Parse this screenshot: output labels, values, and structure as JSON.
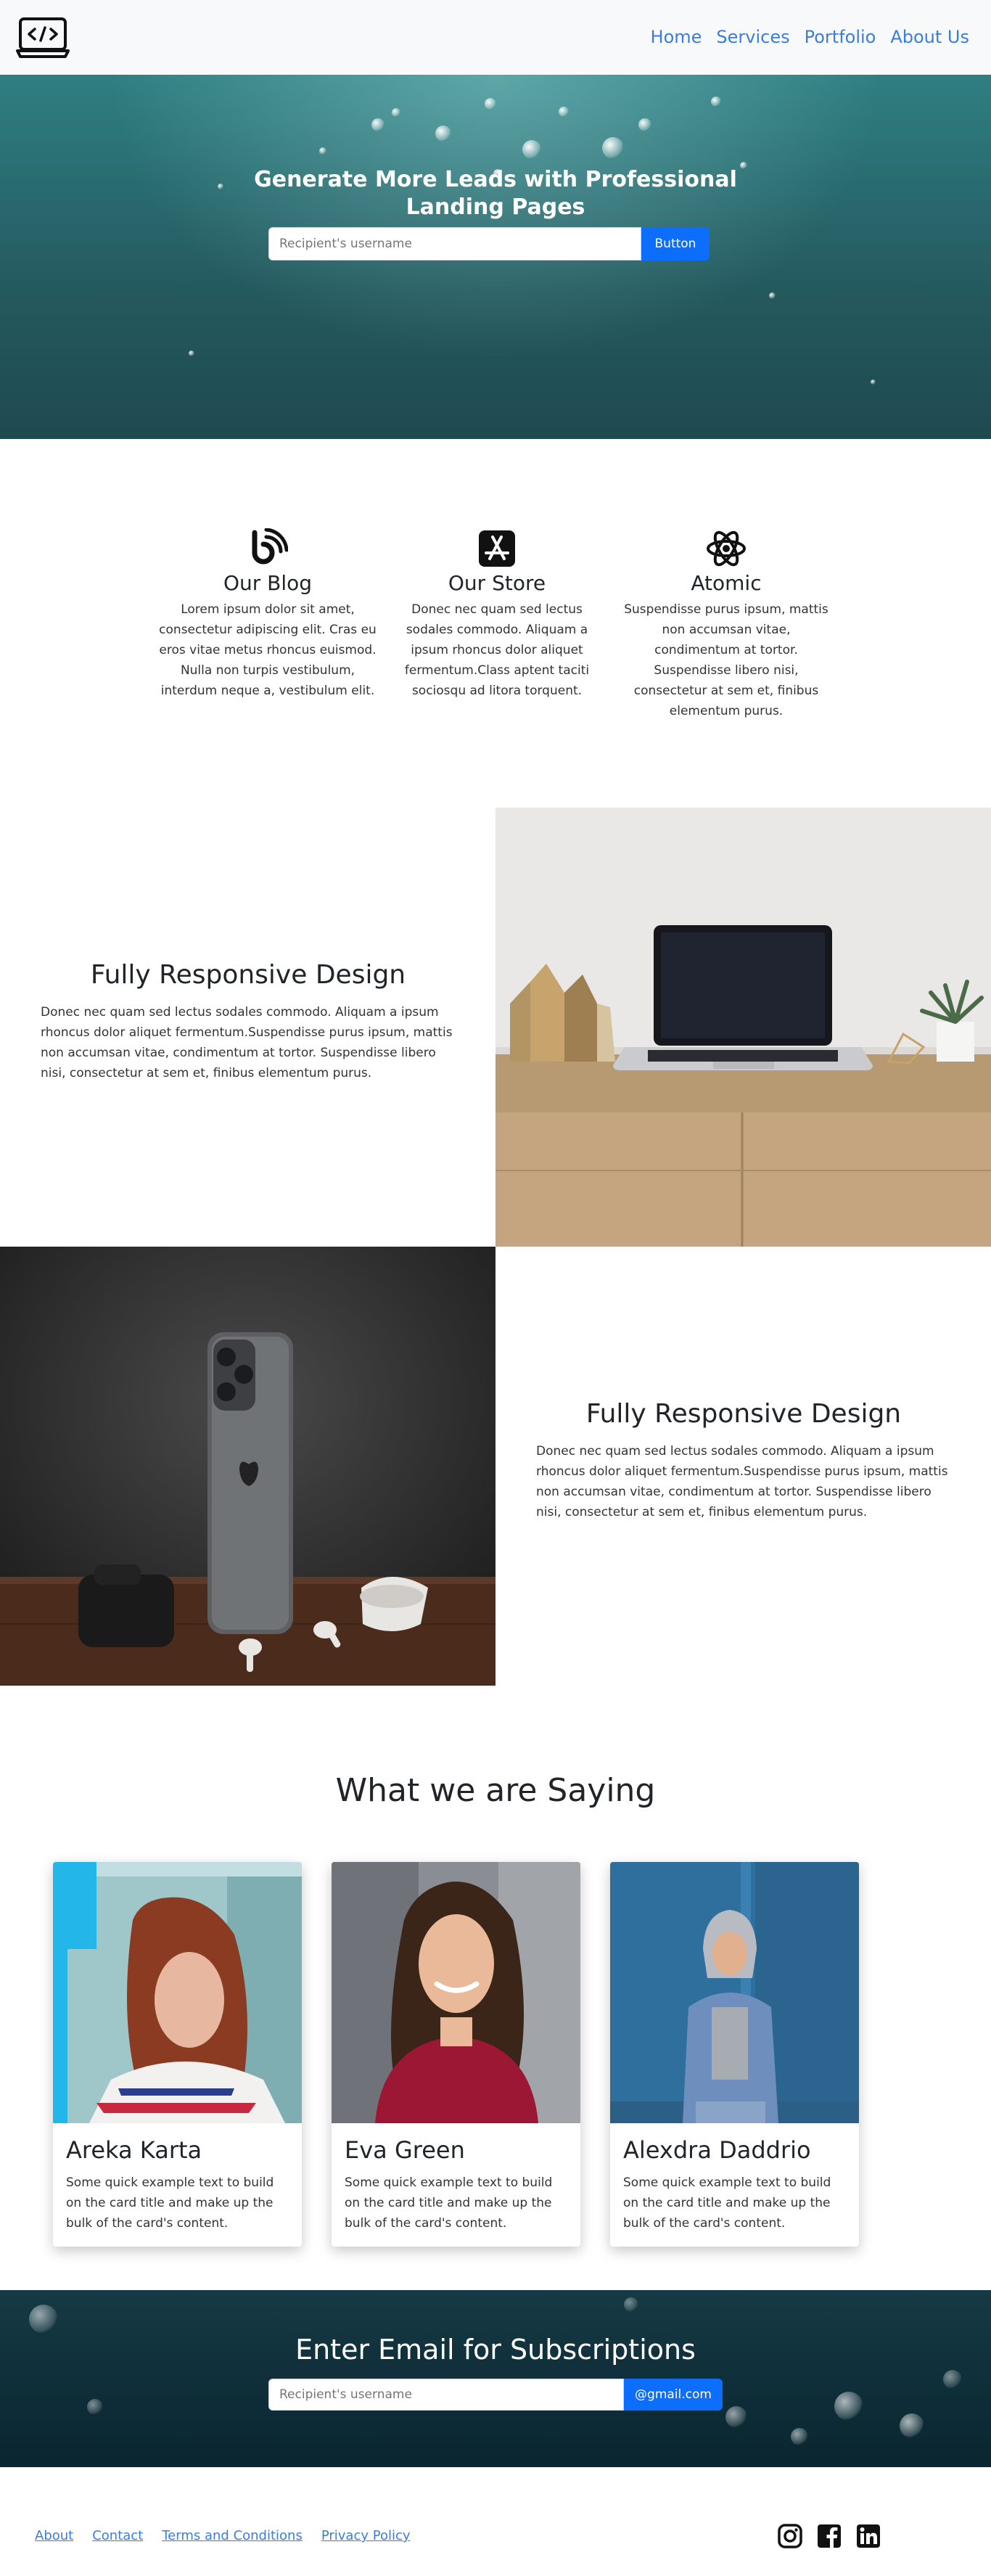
{
  "nav": {
    "links": [
      "Home",
      "Services",
      "Portfolio",
      "About Us"
    ]
  },
  "hero": {
    "title_line1": "Generate More Leads with Professional",
    "title_line2": "Landing Pages",
    "input_placeholder": "Recipient's username",
    "button_label": "Button"
  },
  "features": [
    {
      "icon": "blog-rss-icon",
      "title": "Our Blog",
      "text": "Lorem ipsum dolor sit amet, consectetur adipiscing elit. Cras eu eros vitae metus rhoncus euismod. Nulla non turpis vestibulum, interdum neque a, vestibulum elit."
    },
    {
      "icon": "app-store-icon",
      "title": "Our Store",
      "text": "Donec nec quam sed lectus sodales commodo. Aliquam a ipsum rhoncus dolor aliquet fermentum.Class aptent taciti sociosqu ad litora torquent."
    },
    {
      "icon": "atom-icon",
      "title": "Atomic",
      "text": "Suspendisse purus ipsum, mattis non accumsan vitae, condimentum at tortor. Suspendisse libero nisi, consectetur at sem et, finibus elementum purus."
    }
  ],
  "split1": {
    "title": "Fully Responsive Design",
    "body": "Donec nec quam sed lectus sodales commodo. Aliquam a ipsum rhoncus dolor aliquet fermentum.Suspendisse purus ipsum, mattis non accumsan vitae, condimentum at tortor. Suspendisse libero nisi, consectetur at sem et, finibus elementum purus."
  },
  "split2": {
    "title": "Fully Responsive Design",
    "body": "Donec nec quam sed lectus sodales commodo. Aliquam a ipsum rhoncus dolor aliquet fermentum.Suspendisse purus ipsum, mattis non accumsan vitae, condimentum at tortor. Suspendisse libero nisi, consectetur at sem et, finibus elementum purus."
  },
  "testimonials": {
    "title": "What we are Saying",
    "cards": [
      {
        "name": "Areka Karta",
        "text": "Some quick example text to build on the card title and make up the bulk of the card's content."
      },
      {
        "name": "Eva Green",
        "text": "Some quick example text to build on the card title and make up the bulk of the card's content."
      },
      {
        "name": "Alexdra Daddrio",
        "text": "Some quick example text to build on the card title and make up the bulk of the card's content."
      }
    ]
  },
  "subscribe": {
    "title": "Enter Email for Subscriptions",
    "input_placeholder": "Recipient's username",
    "addon": "@gmail.com"
  },
  "footer": {
    "links": [
      "About",
      "Contact",
      "Terms and Conditions",
      "Privacy Policy"
    ],
    "socials": [
      "instagram-icon",
      "facebook-icon",
      "linkedin-icon"
    ]
  },
  "colors": {
    "primary": "#0d6efd",
    "link": "#3b7ddd",
    "navbar_bg": "#f8f9fa",
    "hero_teal": "#2a6f73"
  }
}
